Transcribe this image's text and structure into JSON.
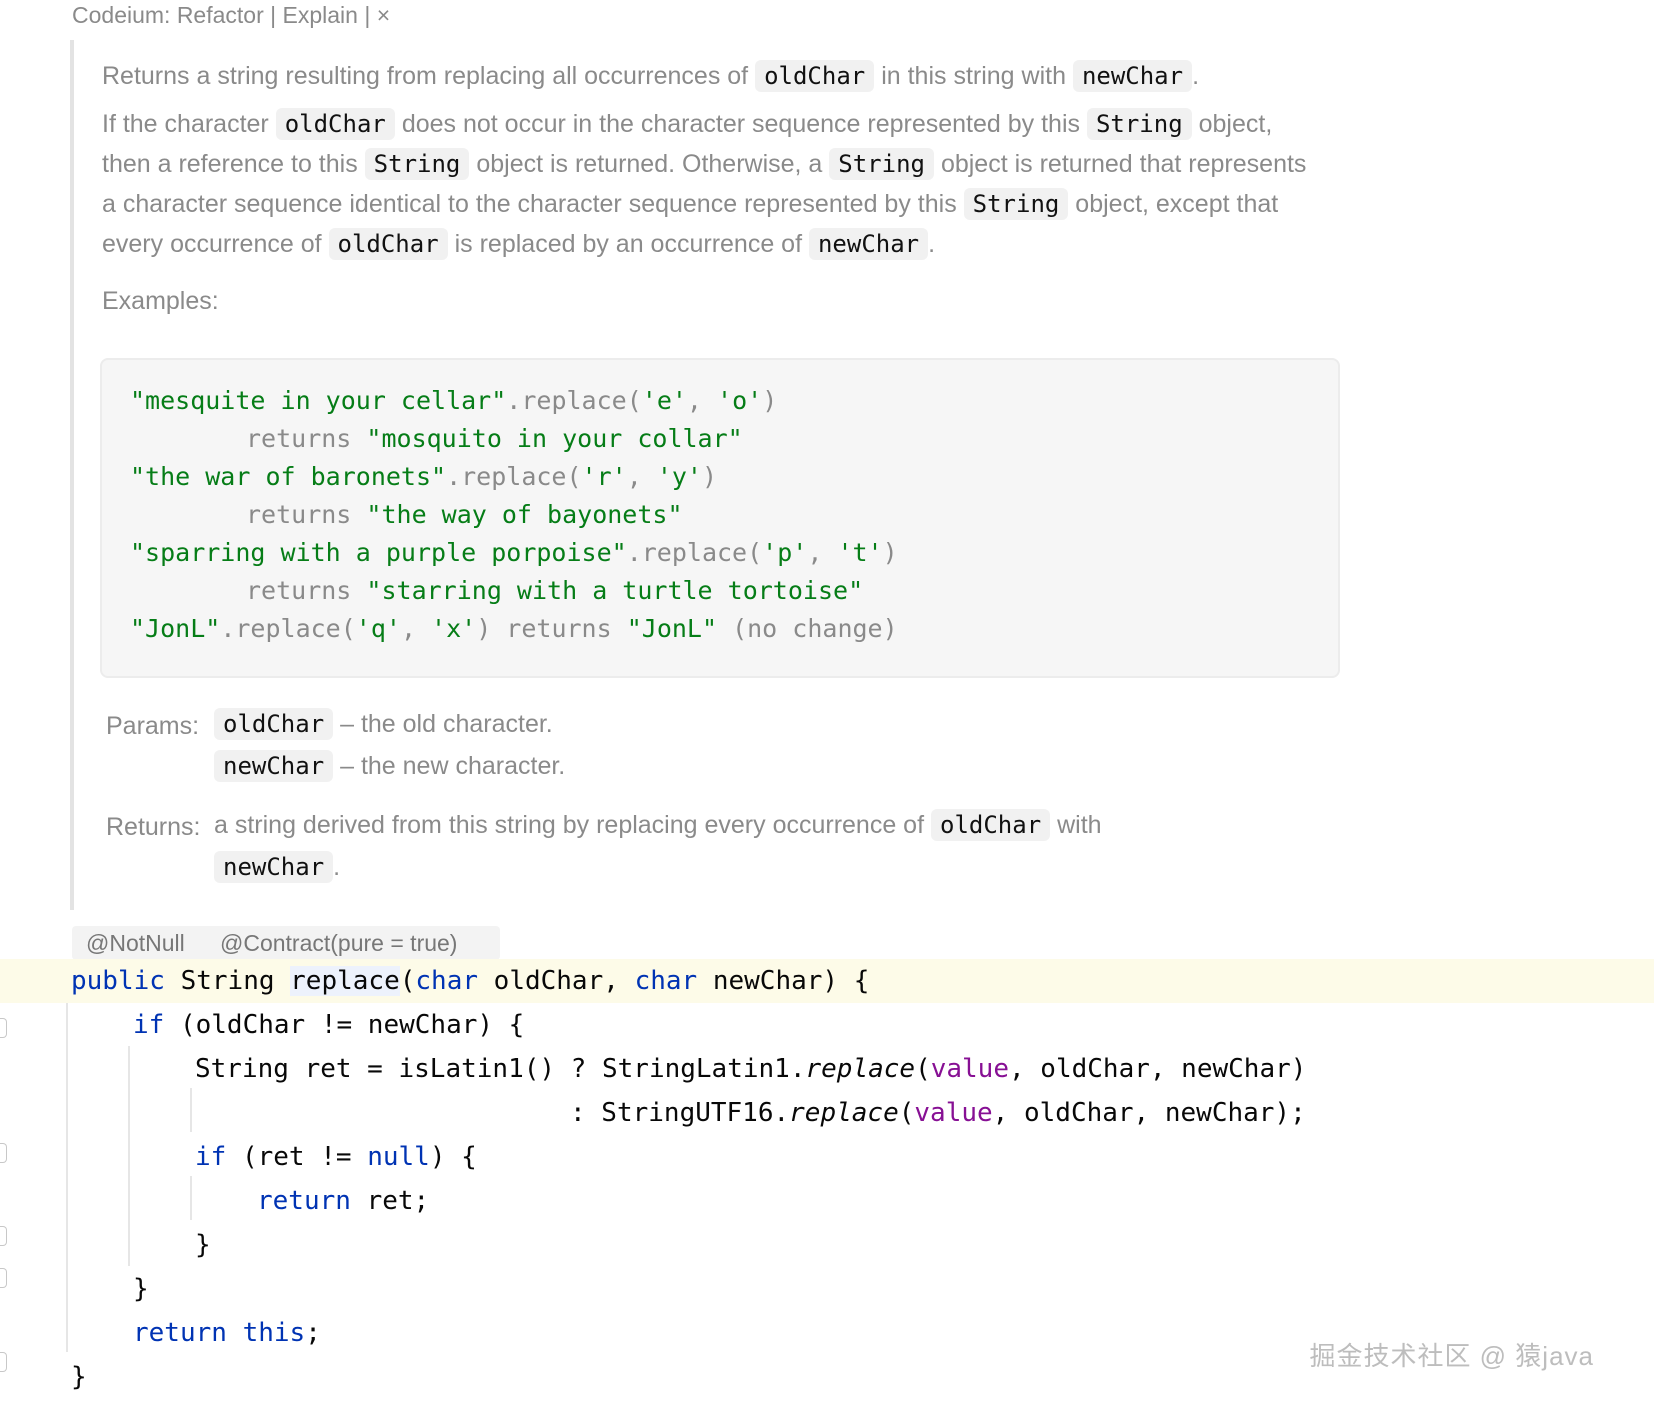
{
  "lens": {
    "title": "Codeium: Refactor",
    "sep1": "|",
    "explain": "Explain",
    "sep2": "|",
    "close": "×"
  },
  "doc": {
    "summary": {
      "t1": "Returns a string resulting from replacing all occurrences of",
      "c1": "oldChar",
      "t2": "in this string with",
      "c2": "newChar",
      "t3": "."
    },
    "para2": {
      "t1": "If the character",
      "c1": "oldChar",
      "t2": "does not occur in the character sequence represented by this",
      "c2": "String",
      "t3": "object, then a reference to this",
      "c3": "String",
      "t4": "object is returned. Otherwise, a",
      "c4": "String",
      "t5": "object is returned that represents a character sequence identical to the character sequence represented by this",
      "c5": "String",
      "t6": "object, except that every occurrence of",
      "c6": "oldChar",
      "t7": "is replaced by an occurrence of",
      "c7": "newChar",
      "t8": "."
    },
    "examples_label": "Examples:",
    "examples": [
      {
        "s": "\"mesquite in your cellar\"",
        "m": ".replace(",
        "a1": "'e'",
        "c": ", ",
        "a2": "'o'",
        "e": ")"
      },
      {
        "r": "returns ",
        "s": "\"mosquito in your collar\""
      },
      {
        "s": "\"the war of baronets\"",
        "m": ".replace(",
        "a1": "'r'",
        "c": ", ",
        "a2": "'y'",
        "e": ")"
      },
      {
        "r": "returns ",
        "s": "\"the way of bayonets\""
      },
      {
        "s": "\"sparring with a purple porpoise\"",
        "m": ".replace(",
        "a1": "'p'",
        "c": ", ",
        "a2": "'t'",
        "e": ")"
      },
      {
        "r": "returns ",
        "s": "\"starring with a turtle tortoise\""
      },
      {
        "s": "\"JonL\"",
        "m": ".replace(",
        "a1": "'q'",
        "c": ", ",
        "a2": "'x'",
        "e": ") returns ",
        "s2": "\"JonL\"",
        "tail": " (no change)"
      }
    ],
    "params_label": "Params:",
    "params": [
      {
        "name": "oldChar",
        "desc": "– the old character."
      },
      {
        "name": "newChar",
        "desc": "– the new character."
      }
    ],
    "returns_label": "Returns:",
    "returns": {
      "t1": "a string derived from this string by replacing every occurrence of",
      "c1": "oldChar",
      "t2": "with",
      "c2": "newChar",
      "t3": "."
    }
  },
  "annotations": [
    "@NotNull",
    "@Contract(pure = true)"
  ],
  "code": {
    "l1": {
      "kw1": "public",
      "type": " String ",
      "method": "replace",
      "p1": "(",
      "kw2": "char",
      "a1": " oldChar, ",
      "kw3": "char",
      "a2": " newChar) {"
    },
    "l2": {
      "kw": "if",
      "rest": " (oldChar != newChar) {"
    },
    "l3": {
      "pre": "String ret = isLatin1() ? StringLatin1.",
      "m": "replace",
      "p": "(",
      "f": "value",
      "rest": ", oldChar, newChar)"
    },
    "l4": {
      "pre": ": StringUTF16.",
      "m": "replace",
      "p": "(",
      "f": "value",
      "rest": ", oldChar, newChar);"
    },
    "l5": {
      "kw": "if",
      "mid": " (ret != ",
      "kw2": "null",
      "rest": ") {"
    },
    "l6": {
      "kw": "return",
      "rest": " ret;"
    },
    "l7": "}",
    "l8": "}",
    "l9": {
      "kw": "return",
      "sp": " ",
      "kw2": "this",
      "rest": ";"
    },
    "l10": "}"
  },
  "watermark": "掘金技术社区 @ 猿java"
}
